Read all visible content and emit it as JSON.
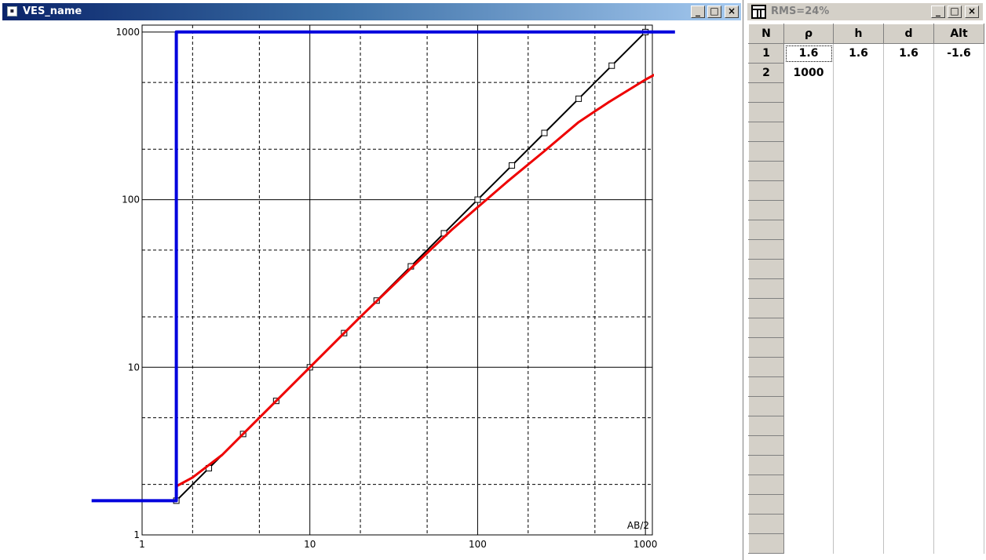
{
  "left_window": {
    "title": "VES_name",
    "icon": "ves-app-icon",
    "buttons": {
      "minimize": "_",
      "maximize": "□",
      "close": "×"
    }
  },
  "chart_data": {
    "type": "line",
    "xscale": "log",
    "yscale": "log",
    "xlim": [
      1,
      1100
    ],
    "ylim": [
      1,
      1100
    ],
    "x_ticks": [
      1,
      10,
      100,
      1000
    ],
    "y_ticks": [
      1,
      10,
      100,
      1000
    ],
    "x_tick_labels": [
      "1",
      "10",
      "100",
      "1000"
    ],
    "y_tick_labels": [
      "1",
      "10",
      "100",
      "1000"
    ],
    "x_minor_dashed": [
      2,
      5,
      20,
      50,
      200,
      500
    ],
    "y_minor_dashed": [
      2,
      5,
      20,
      50,
      200,
      500
    ],
    "grid": true,
    "xlabel": "AB/2",
    "ylabel": "",
    "series": [
      {
        "kind": "model",
        "color": "#0000dd",
        "x": [
          0.5,
          1.6,
          1.6,
          1500
        ],
        "y": [
          1.6,
          1.6,
          1000,
          1000
        ]
      },
      {
        "kind": "observed",
        "color": "#000000",
        "marker": "square",
        "x": [
          1.6,
          2.5,
          4,
          6.3,
          10,
          16,
          25,
          40,
          63,
          100,
          160,
          250,
          400,
          630,
          1000
        ],
        "y": [
          1.6,
          2.5,
          4,
          6.3,
          10,
          16,
          25,
          40,
          63,
          100,
          160,
          250,
          400,
          630,
          1000
        ]
      },
      {
        "kind": "calculated",
        "color": "#ee0000",
        "x": [
          1.6,
          2,
          3,
          5,
          10,
          20,
          40,
          70,
          100,
          150,
          250,
          400,
          600,
          1000,
          1300
        ],
        "y": [
          1.95,
          2.2,
          3.0,
          5.0,
          10,
          20,
          39,
          66,
          90,
          128,
          195,
          290,
          380,
          520,
          600
        ]
      }
    ]
  },
  "right_window": {
    "title": "RMS=24%",
    "icon": "table-icon",
    "buttons": {
      "minimize": "_",
      "maximize": "□",
      "close": "×"
    },
    "table": {
      "headers": [
        "N",
        "ρ",
        "h",
        "d",
        "Alt"
      ],
      "rows": [
        [
          "1",
          "1.6",
          "1.6",
          "1.6",
          "-1.6"
        ],
        [
          "2",
          "1000",
          "",
          "",
          ""
        ]
      ]
    }
  }
}
